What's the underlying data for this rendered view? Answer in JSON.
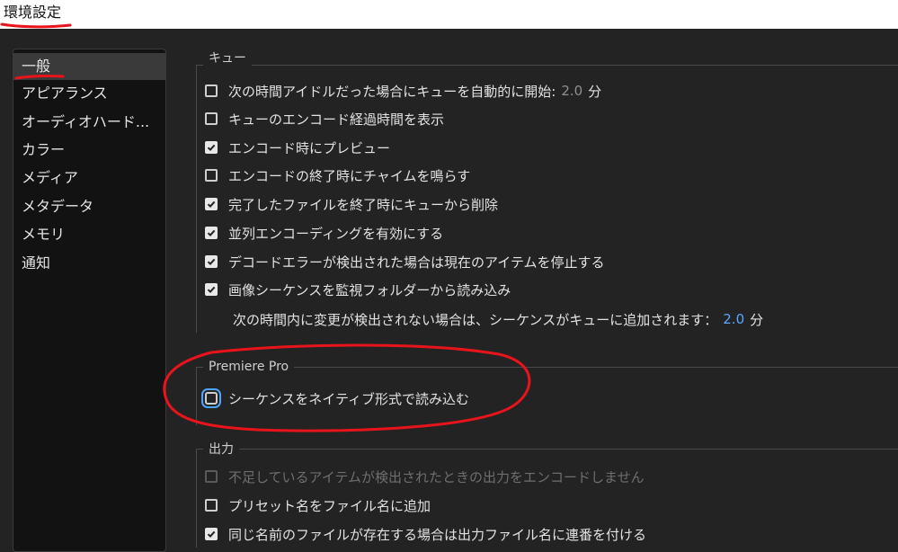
{
  "window": {
    "title": "環境設定"
  },
  "sidebar": {
    "items": [
      {
        "label": "一般",
        "active": true
      },
      {
        "label": "アピアランス"
      },
      {
        "label": "オーディオハード..."
      },
      {
        "label": "カラー"
      },
      {
        "label": "メディア"
      },
      {
        "label": "メタデータ"
      },
      {
        "label": "メモリ"
      },
      {
        "label": "通知"
      }
    ]
  },
  "queue": {
    "title": "キュー",
    "items": [
      {
        "label": "次の時間アイドルだった場合にキューを自動的に開始:",
        "checked": false,
        "value": "2.0",
        "unit": "分"
      },
      {
        "label": "キューのエンコード経過時間を表示",
        "checked": false
      },
      {
        "label": "エンコード時にプレビュー",
        "checked": true
      },
      {
        "label": "エンコードの終了時にチャイムを鳴らす",
        "checked": false
      },
      {
        "label": "完了したファイルを終了時にキューから削除",
        "checked": true
      },
      {
        "label": "並列エンコーディングを有効にする",
        "checked": true
      },
      {
        "label": "デコードエラーが検出された場合は現在のアイテムを停止する",
        "checked": true
      },
      {
        "label": "画像シーケンスを監視フォルダーから読み込み",
        "checked": true
      }
    ],
    "note": {
      "label": "次の時間内に変更が検出されない場合は、シーケンスがキューに追加されます：",
      "value": "2.0",
      "unit": "分"
    }
  },
  "premiere": {
    "title": "Premiere Pro",
    "items": [
      {
        "label": "シーケンスをネイティブ形式で読み込む",
        "checked": false,
        "focused": true
      }
    ]
  },
  "output": {
    "title": "出力",
    "items": [
      {
        "label": "不足しているアイテムが検出されたときの出力をエンコードしません",
        "checked": false,
        "disabled": true
      },
      {
        "label": "プリセット名をファイル名に追加",
        "checked": false
      },
      {
        "label": "同じ名前のファイルが存在する場合は出力ファイル名に連番を付ける",
        "checked": true
      }
    ]
  },
  "colors": {
    "accent": "#5aa7ff",
    "annotation": "#e8141c",
    "background": "#232323",
    "sidebar_bg": "#121212"
  }
}
